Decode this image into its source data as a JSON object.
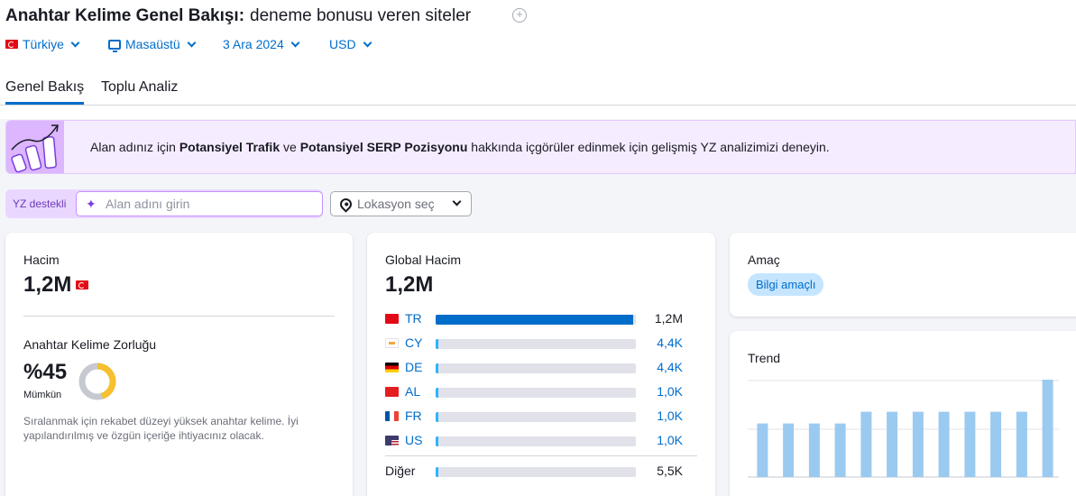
{
  "header": {
    "title": "Anahtar Kelime Genel Bakışı:",
    "keyword": "deneme bonusu veren siteler"
  },
  "filters": {
    "country": "Türkiye",
    "device": "Masaüstü",
    "date": "3 Ara 2024",
    "currency": "USD"
  },
  "tabs": [
    "Genel Bakış",
    "Toplu Analiz"
  ],
  "banner": {
    "text_before": "Alan adınız için",
    "bold1": "Potansiyel Trafik",
    "text_mid": "ve",
    "bold2": "Potansiyel SERP Pozisyonu",
    "text_after": "hakkında içgörüler edinmek için gelişmiş YZ analizimizi deneyin."
  },
  "ai_search": {
    "badge": "YZ destekli",
    "placeholder": "Alan adını girin",
    "location_placeholder": "Lokasyon seç"
  },
  "volume_card": {
    "label": "Hacim",
    "value": "1,2M",
    "difficulty_label": "Anahtar Kelime Zorluğu",
    "difficulty_value": "%45",
    "difficulty_percent": 45,
    "difficulty_level": "Mümkün",
    "difficulty_desc": "Sıralanmak için rekabet düzeyi yüksek anahtar kelime. İyi yapılandırılmış ve özgün içeriğe ihtiyacınız olacak."
  },
  "global_card": {
    "label": "Global Hacim",
    "value": "1,2M",
    "countries": [
      {
        "code": "TR",
        "value": "1,2M",
        "fraction": 0.985
      },
      {
        "code": "CY",
        "value": "4,4K",
        "fraction": 0.012
      },
      {
        "code": "DE",
        "value": "4,4K",
        "fraction": 0.012
      },
      {
        "code": "AL",
        "value": "1,0K",
        "fraction": 0.012
      },
      {
        "code": "FR",
        "value": "1,0K",
        "fraction": 0.012
      },
      {
        "code": "US",
        "value": "1,0K",
        "fraction": 0.012
      }
    ],
    "other_label": "Diğer",
    "other_value": "5,5K",
    "other_fraction": 0.012
  },
  "intent_card": {
    "label": "Amaç",
    "intent": "Bilgi amaçlı"
  },
  "trend_card": {
    "label": "Trend",
    "bar_levels": [
      0.55,
      0.55,
      0.55,
      0.55,
      0.67,
      0.67,
      0.67,
      0.67,
      0.67,
      0.67,
      0.67,
      1.0
    ]
  },
  "colors": {
    "accent": "#006dca",
    "difficulty": "#f6c02e",
    "trend_bar": "#9bcaf0"
  }
}
